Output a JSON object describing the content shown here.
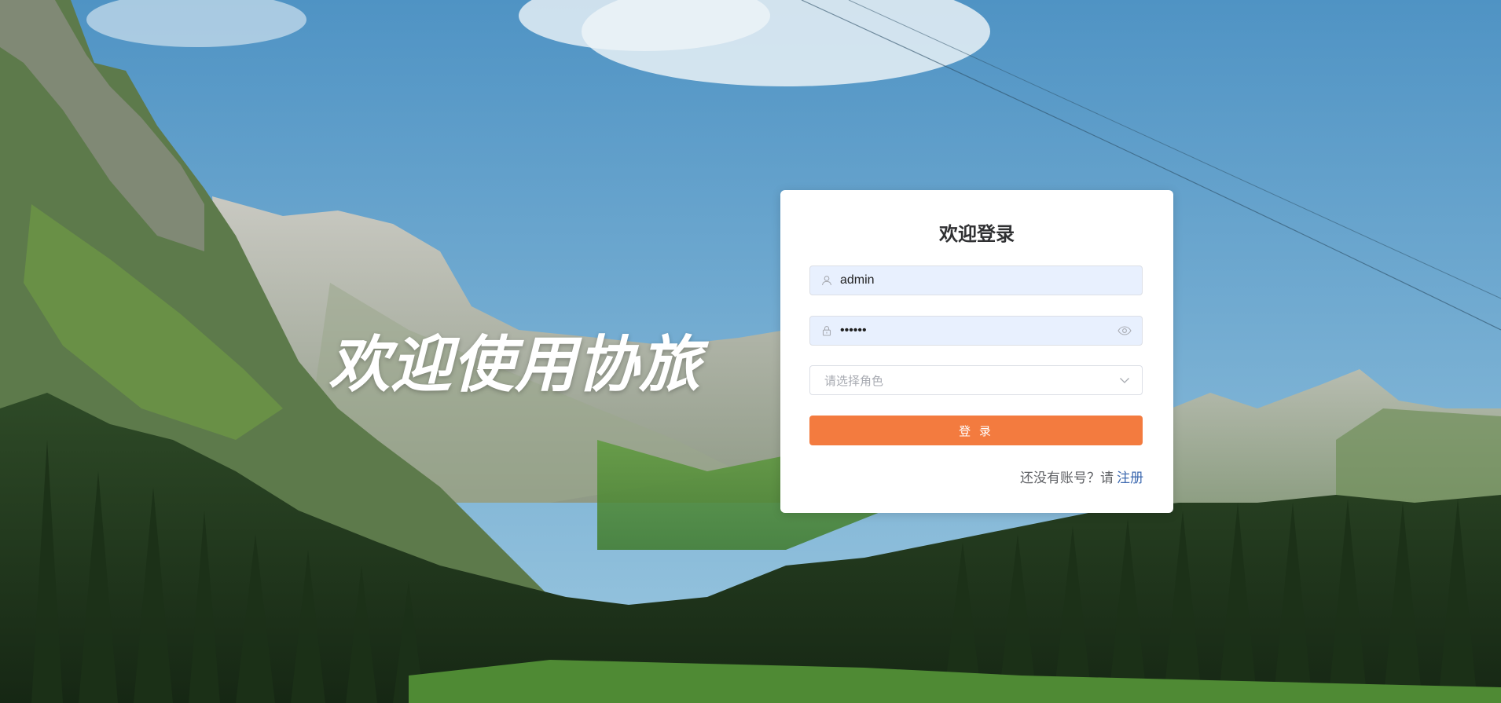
{
  "hero": {
    "title": "欢迎使用协旅"
  },
  "login": {
    "title": "欢迎登录",
    "username": {
      "value": "admin",
      "icon": "user-icon"
    },
    "password": {
      "value": "••••••",
      "icon": "lock-icon",
      "toggle_icon": "eye-icon"
    },
    "role": {
      "placeholder": "请选择角色",
      "icon": "chevron-down-icon"
    },
    "submit_label": "登 录",
    "register_prompt": "还没有账号？请",
    "register_link": "注册"
  },
  "colors": {
    "primary": "#f37b3f",
    "link": "#3e6ab0",
    "autofill_bg": "#e8f0fe"
  }
}
